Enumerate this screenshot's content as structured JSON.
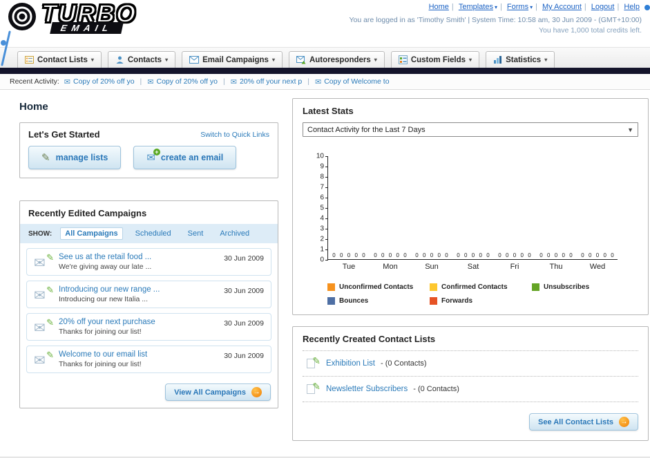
{
  "header": {
    "logo": {
      "primary": "TURBO",
      "secondary": "EMAIL"
    },
    "top_links": [
      "Home",
      "Templates",
      "Forms",
      "My Account",
      "Logout",
      "Help"
    ],
    "login_info": "You are logged in as 'Timothy Smith' | System Time: 10:58 am, 30 Jun 2009 - (GMT+10:00)",
    "credits_info": "You have 1,000 total credits left."
  },
  "main_nav": {
    "items": [
      {
        "label": "Contact Lists"
      },
      {
        "label": "Contacts"
      },
      {
        "label": "Email Campaigns"
      },
      {
        "label": "Autoresponders"
      },
      {
        "label": "Custom Fields"
      },
      {
        "label": "Statistics"
      }
    ]
  },
  "recent_activity": {
    "label": "Recent Activity:",
    "items": [
      "Copy of 20% off yo",
      "Copy of 20% off yo",
      "20% off your next p",
      "Copy of Welcome to"
    ]
  },
  "page": {
    "title": "Home"
  },
  "get_started": {
    "title": "Let's Get Started",
    "switch_link": "Switch to Quick Links",
    "manage_lists_label": "manage lists",
    "create_email_label": "create an email"
  },
  "campaigns": {
    "title": "Recently Edited Campaigns",
    "show_label": "SHOW:",
    "tabs": [
      "All Campaigns",
      "Scheduled",
      "Sent",
      "Archived"
    ],
    "items": [
      {
        "title": "See us at the retail food ...",
        "subtitle": "We're giving away our late ...",
        "date": "30 Jun 2009"
      },
      {
        "title": "Introducing our new range ...",
        "subtitle": "Introducing our new Italia ...",
        "date": "30 Jun 2009"
      },
      {
        "title": "20% off your next purchase",
        "subtitle": "Thanks for joining our list!",
        "date": "30 Jun 2009"
      },
      {
        "title": "Welcome to our email list",
        "subtitle": "Thanks for joining our list!",
        "date": "30 Jun 2009"
      }
    ],
    "view_all_label": "View All Campaigns"
  },
  "stats": {
    "title": "Latest Stats",
    "dropdown_value": "Contact Activity for the Last 7 Days",
    "chart_data": {
      "type": "bar",
      "title": "Contact Activity for the Last 7 Days",
      "categories": [
        "Tue",
        "Mon",
        "Sun",
        "Sat",
        "Fri",
        "Thu",
        "Wed"
      ],
      "series": [
        {
          "name": "Unconfirmed Contacts",
          "color": "#f6921e",
          "values": [
            0,
            0,
            0,
            0,
            0,
            0,
            0
          ]
        },
        {
          "name": "Confirmed Contacts",
          "color": "#fdc72f",
          "values": [
            0,
            0,
            0,
            0,
            0,
            0,
            0
          ]
        },
        {
          "name": "Unsubscribes",
          "color": "#64a425",
          "values": [
            0,
            0,
            0,
            0,
            0,
            0,
            0
          ]
        },
        {
          "name": "Bounces",
          "color": "#4e6fa4",
          "values": [
            0,
            0,
            0,
            0,
            0,
            0,
            0
          ]
        },
        {
          "name": "Forwards",
          "color": "#e65325",
          "values": [
            0,
            0,
            0,
            0,
            0,
            0,
            0
          ]
        }
      ],
      "xlabel": "",
      "ylabel": "",
      "ylim": [
        0,
        10
      ],
      "yticks": [
        0,
        1,
        2,
        3,
        4,
        5,
        6,
        7,
        8,
        9,
        10
      ],
      "grid": false,
      "legend_position": "bottom"
    }
  },
  "contact_lists": {
    "title": "Recently Created Contact Lists",
    "items": [
      {
        "name": "Exhibition List",
        "detail": "- (0 Contacts)"
      },
      {
        "name": "Newsletter Subscribers",
        "detail": "- (0 Contacts)"
      }
    ],
    "see_all_label": "See All Contact Lists"
  }
}
